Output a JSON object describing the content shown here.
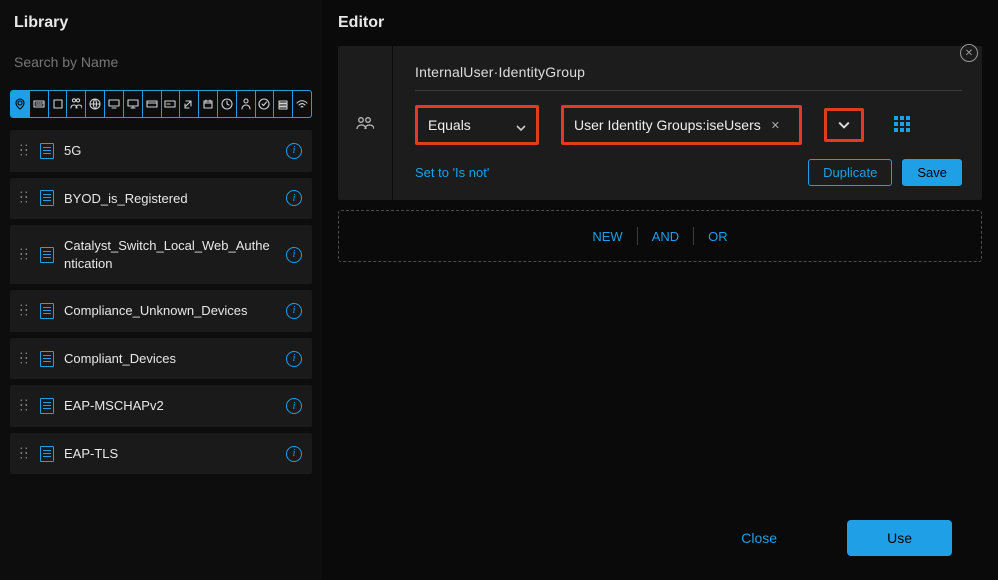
{
  "library": {
    "title": "Library",
    "search_placeholder": "Search by Name",
    "filter_icons": [
      "pin-icon",
      "keyboard-icon",
      "square-icon",
      "group-icon",
      "globe-icon",
      "monitor-icon",
      "monitor2-icon",
      "card-icon",
      "card2-icon",
      "external-icon",
      "calendar-icon",
      "clock-icon",
      "person-icon",
      "check-icon",
      "stack-icon",
      "wifi-icon"
    ],
    "selected_filter_index": 0,
    "items": [
      {
        "label": "5G"
      },
      {
        "label": "BYOD_is_Registered"
      },
      {
        "label": "Catalyst_Switch_Local_Web_Authentication"
      },
      {
        "label": "Compliance_Unknown_Devices"
      },
      {
        "label": "Compliant_Devices"
      },
      {
        "label": "EAP-MSCHAPv2"
      },
      {
        "label": "EAP-TLS"
      }
    ]
  },
  "editor": {
    "title": "Editor",
    "condition": {
      "attribute": "InternalUser·IdentityGroup",
      "operator": "Equals",
      "value": "User Identity Groups:iseUsers",
      "toggle_link": "Set to 'Is not'",
      "duplicate_label": "Duplicate",
      "save_label": "Save"
    },
    "add_slot": {
      "new": "NEW",
      "and": "AND",
      "or": "OR"
    }
  },
  "footer": {
    "close": "Close",
    "use": "Use"
  }
}
